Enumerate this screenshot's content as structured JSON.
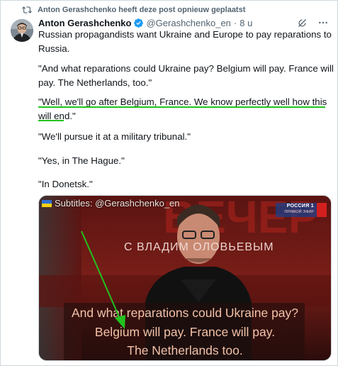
{
  "repost": {
    "text": "Anton Gerashchenko heeft deze post opnieuw geplaatst",
    "icon": "repost-icon"
  },
  "author": {
    "display_name": "Anton Gerashchenko",
    "handle": "@Gerashchenko_en",
    "separator": "·",
    "time": "8 u",
    "verified_icon": "verified-badge-icon"
  },
  "tweet": {
    "paragraphs": [
      "Russian propagandists want Ukraine and Europe to pay reparations to Russia.",
      "\"And what reparations could Ukraine pay? Belgium will pay. France will pay. The Netherlands, too.\"",
      "\"Well, we'll go after Belgium, France. We know perfectly well how this will end.\"",
      "\"We'll pursue it at a military tribunal.\"",
      "\"Yes, in The Hague.\"",
      "\"In Donetsk.\""
    ]
  },
  "media": {
    "subtitle_credit": "Subtitles: @Gerashchenko_en",
    "channel_name": "РОССИЯ 1",
    "channel_sub": "ПРЯМОЙ ЭФИР",
    "show_title": "С ВЛАДИМ     ОЛОВЬЕВЫМ",
    "captions": [
      "And what reparations could Ukraine pay?",
      "Belgium will pay. France will pay.",
      "The Netherlands too."
    ]
  },
  "colors": {
    "text": "#0f1419",
    "secondary": "#536471",
    "verified": "#1d9bf0",
    "annotation_green": "#22c11f",
    "caption": "#f3c2a8",
    "channel_red": "#d41f1f"
  }
}
